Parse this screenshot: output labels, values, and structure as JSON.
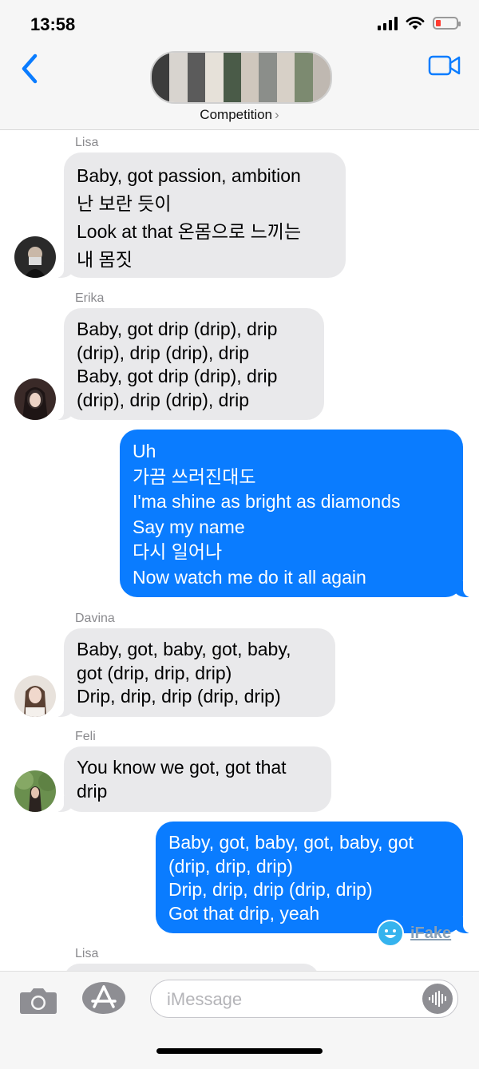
{
  "status_bar": {
    "time": "13:58"
  },
  "header": {
    "group_name": "Competition",
    "chevron": "›"
  },
  "messages": [
    {
      "sender": "Lisa",
      "text": "Baby, got passion, ambition\n난 보란 듯이\nLook at that 온몸으로 느끼는\n내 몸짓"
    },
    {
      "sender": "Erika",
      "text": "Baby, got drip (drip), drip\n(drip), drip (drip), drip\nBaby, got drip (drip), drip\n(drip), drip (drip), drip"
    },
    {
      "sender": "",
      "text": "Uh\n가끔 쓰러진대도\nI'ma shine as bright as diamonds\nSay my name\n다시 일어나\nNow watch me do it all again"
    },
    {
      "sender": "Davina",
      "text": "Baby, got, baby, got, baby,\ngot (drip, drip, drip)\nDrip, drip, drip (drip, drip)"
    },
    {
      "sender": "Feli",
      "text": "You know we got, got that\ndrip"
    },
    {
      "sender": "",
      "text": "Baby, got, baby, got, baby, got\n(drip, drip, drip)\nDrip, drip, drip (drip, drip)\nGot that drip, yeah"
    },
    {
      "sender": "Lisa",
      "text": ""
    }
  ],
  "watermark": "iFake",
  "composer": {
    "placeholder": "iMessage"
  },
  "colors": {
    "accent": "#0a7cff",
    "incoming": "#e9e9eb",
    "battery": "#ff3b30"
  },
  "icons": [
    "back-chevron-icon",
    "video-call-icon",
    "camera-icon",
    "app-store-icon",
    "audio-waveform-icon",
    "signal-icon",
    "wifi-icon",
    "battery-icon"
  ]
}
